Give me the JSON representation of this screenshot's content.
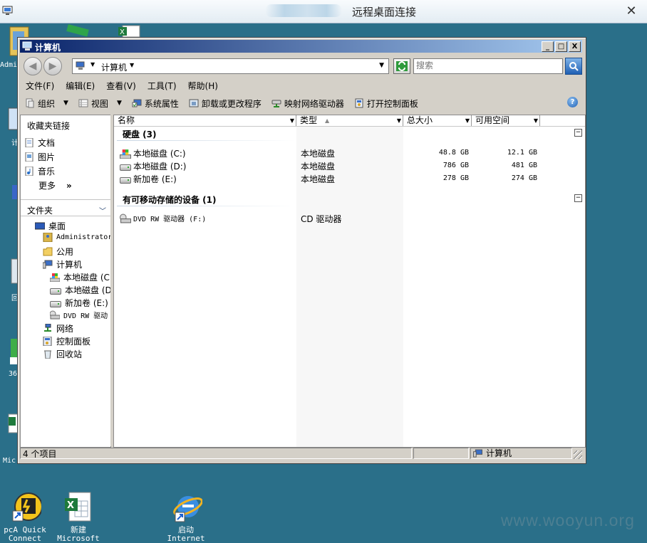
{
  "rdp": {
    "title": "远程桌面连接",
    "close_glyph": "✕"
  },
  "desktop": {
    "icons_left_edge": [
      "Admi",
      "计",
      "回",
      "36",
      "Mic"
    ],
    "bottom_icons": [
      {
        "label1": "pcA Quick",
        "label2": "Connect"
      },
      {
        "label1": "新建",
        "label2": "Microsoft"
      },
      {
        "label1": "启动",
        "label2": "Internet"
      }
    ],
    "watermark": "www.wooyun.org"
  },
  "window": {
    "title": "计算机",
    "buttons": {
      "minimize": "_",
      "maximize": "□",
      "close": "X"
    },
    "address": {
      "crumb": "计算机"
    },
    "search": {
      "placeholder": "搜索"
    },
    "menu": [
      "文件(F)",
      "编辑(E)",
      "查看(V)",
      "工具(T)",
      "帮助(H)"
    ],
    "toolbar": {
      "organize": "组织",
      "views": "视图",
      "system_properties": "系统属性",
      "uninstall": "卸载或更改程序",
      "map_drive": "映射网络驱动器",
      "control_panel": "打开控制面板"
    },
    "nav": {
      "favorites_header": "收藏夹链接",
      "favorites": [
        "文档",
        "图片",
        "音乐"
      ],
      "more": "更多",
      "more_glyph": "»",
      "folders_header": "文件夹",
      "tree": [
        {
          "label": "桌面"
        },
        {
          "label": "Administrator"
        },
        {
          "label": "公用"
        },
        {
          "label": "计算机"
        },
        {
          "label": "本地磁盘 (C"
        },
        {
          "label": "本地磁盘 (D"
        },
        {
          "label": "新加卷 (E:)"
        },
        {
          "label": "DVD RW 驱动"
        },
        {
          "label": "网络"
        },
        {
          "label": "控制面板"
        },
        {
          "label": "回收站"
        }
      ]
    },
    "columns": [
      "名称",
      "类型",
      "总大小",
      "可用空间"
    ],
    "groups": [
      {
        "title": "硬盘 (3)",
        "collapse": "⊟",
        "items": [
          {
            "name": "本地磁盘 (C:)",
            "type": "本地磁盘",
            "total": "48.8 GB",
            "free": "12.1 GB"
          },
          {
            "name": "本地磁盘 (D:)",
            "type": "本地磁盘",
            "total": "786 GB",
            "free": "481 GB"
          },
          {
            "name": "新加卷 (E:)",
            "type": "本地磁盘",
            "total": "278 GB",
            "free": "274 GB"
          }
        ]
      },
      {
        "title": "有可移动存储的设备 (1)",
        "collapse": "⊟",
        "items": [
          {
            "name": "DVD RW 驱动器 (F:)",
            "type": "CD 驱动器",
            "total": "",
            "free": ""
          }
        ]
      }
    ],
    "status": {
      "count": "4 个项目",
      "location": "计算机"
    }
  },
  "colors": {
    "desktop_bg": "#2a6f89",
    "titlebar_start": "#0a246a",
    "titlebar_end": "#a6caf0",
    "watermark": "#4d7f92"
  }
}
